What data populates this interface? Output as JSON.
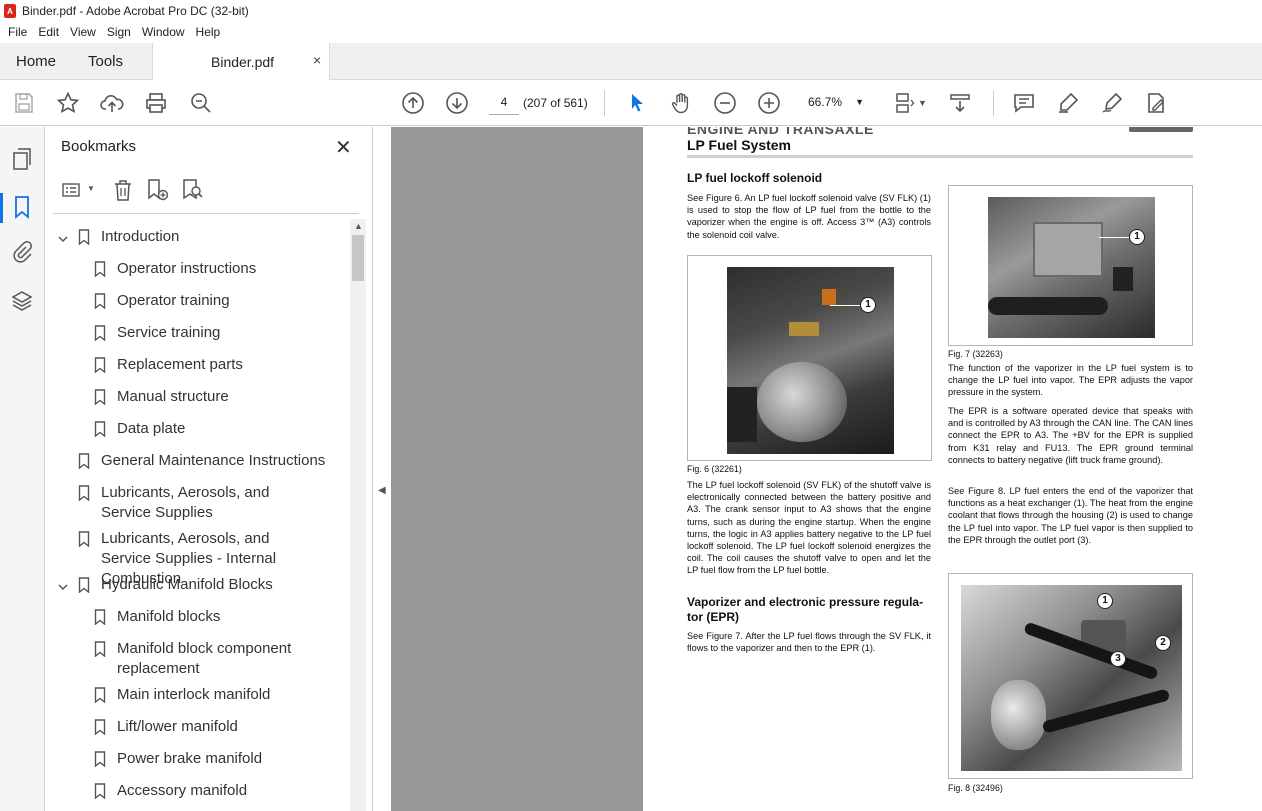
{
  "window": {
    "title": "Binder.pdf - Adobe Acrobat Pro DC (32-bit)"
  },
  "menu": [
    "File",
    "Edit",
    "View",
    "Sign",
    "Window",
    "Help"
  ],
  "tabs": {
    "home": "Home",
    "tools": "Tools",
    "document": "Binder.pdf",
    "close": "×"
  },
  "toolbar": {
    "page_number": "4",
    "page_count": "(207 of 561)",
    "zoom": "66.7%"
  },
  "panel": {
    "title": "Bookmarks",
    "close": "✕",
    "bookmarks": [
      {
        "label": "Introduction",
        "expanded": true
      },
      {
        "label": "Operator instructions"
      },
      {
        "label": "Operator training"
      },
      {
        "label": "Service training"
      },
      {
        "label": "Replacement parts"
      },
      {
        "label": "Manual structure"
      },
      {
        "label": "Data plate"
      },
      {
        "label": "General Maintenance Instructions"
      },
      {
        "label": "Lubricants, Aerosols, and Service Supplies"
      },
      {
        "label": "Lubricants, Aerosols, and Service Supplies - Internal Combustion"
      },
      {
        "label": "Hydraulic Manifold Blocks",
        "expanded": true
      },
      {
        "label": "Manifold blocks"
      },
      {
        "label": "Manifold block component replacement"
      },
      {
        "label": "Main interlock manifold"
      },
      {
        "label": "Lift/lower manifold"
      },
      {
        "label": "Power brake manifold"
      },
      {
        "label": "Accessory manifold"
      }
    ]
  },
  "document": {
    "header_cut": "ENGINE AND TRANSAXLE",
    "title": "LP Fuel System",
    "section1_heading": "LP fuel lockoff solenoid",
    "p1": "See Figure 6. An LP fuel lockoff solenoid valve (SV FLK) (1) is used to stop the flow of LP fuel from the bottle to the vaporizer when the engine is off. Access 3™ (A3) controls the solenoid coil valve.",
    "fig6_caption": "Fig. 6 (32261)",
    "p2": "The LP fuel lockoff solenoid (SV FLK) of the shutoff valve is electronically connected between the battery positive and A3. The crank sensor input to A3 shows that the engine turns, such as during the engine startup. When the engine turns, the logic in A3 applies battery negative to the LP fuel lockoff solenoid. The LP fuel lockoff solenoid energizes the coil. The coil causes the shutoff valve to open and let the LP fuel flow from the LP fuel bottle.",
    "section2_heading_1": "Vaporizer and electronic pressure regula-",
    "section2_heading_2": "tor (EPR)",
    "p3": "See Figure 7. After the LP fuel flows through the SV FLK, it flows to the vaporizer and then to the EPR (1).",
    "fig7_caption": "Fig. 7 (32263)",
    "p4": "The function of the vaporizer in the LP fuel system is to change the LP fuel into vapor. The EPR adjusts the vapor pressure in the system.",
    "p5": "The EPR is a software operated device that speaks with and is controlled by A3 through the CAN line. The CAN lines connect the EPR to A3. The +BV for the EPR is supplied from K31 relay and FU13. The EPR ground terminal connects to battery negative (lift truck frame ground).",
    "p6": "See Figure 8. LP fuel enters the end of the vaporizer that functions as a heat exchanger (1). The heat from the engine coolant that flows through the housing (2) is used to change the LP fuel into vapor. The LP fuel vapor is then supplied to the EPR through the outlet port (3).",
    "fig8_caption": "Fig. 8 (32496)",
    "callouts": {
      "fig6": [
        "1"
      ],
      "fig7": [
        "1"
      ],
      "fig8": [
        "1",
        "2",
        "3"
      ]
    }
  },
  "colors": {
    "accent": "#1473e6",
    "viewer_bg": "#979797",
    "pdf_red": "#d7261e"
  }
}
